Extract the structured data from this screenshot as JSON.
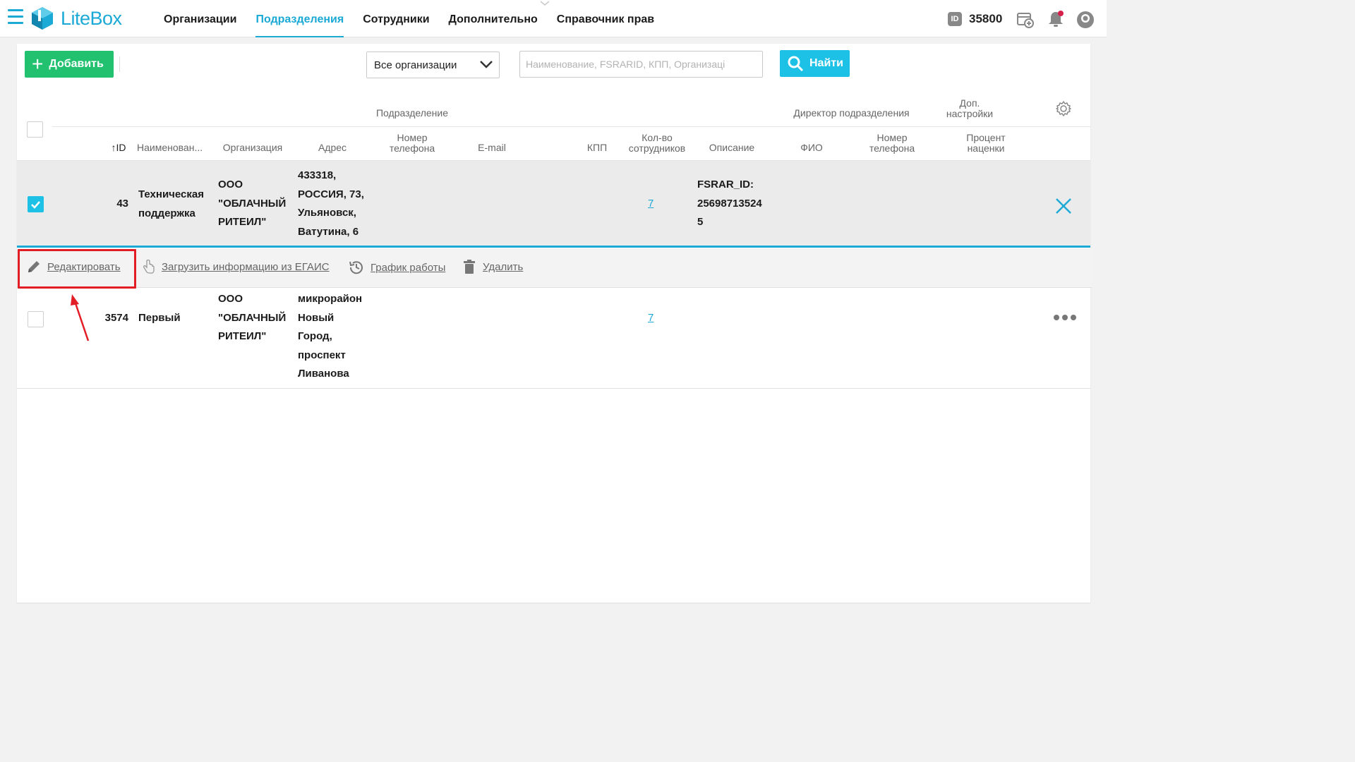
{
  "app": {
    "logo_text": "LiteBox"
  },
  "nav": {
    "items": [
      {
        "label": "Организации",
        "active": false
      },
      {
        "label": "Подразделения",
        "active": true
      },
      {
        "label": "Сотрудники",
        "active": false
      },
      {
        "label": "Дополнительно",
        "active": false
      },
      {
        "label": "Справочник прав",
        "active": false
      }
    ]
  },
  "topbar": {
    "id_badge": "ID",
    "account_id": "35800"
  },
  "toolbar": {
    "add_label": "Добавить",
    "org_select_value": "Все организации",
    "search_placeholder": "Наименование, FSRARID, КПП, Организаці",
    "find_label": "Найти"
  },
  "table": {
    "group_headers": {
      "subdivision": "Подразделение",
      "director": "Директор подразделения",
      "extra_line1": "Доп.",
      "extra_line2": "настройки"
    },
    "columns": {
      "id": "ID",
      "name": "Наименован...",
      "organization": "Организация",
      "address": "Адрес",
      "phone_line1": "Номер",
      "phone_line2": "телефона",
      "email": "E-mail",
      "kpp": "КПП",
      "employees_line1": "Кол-во",
      "employees_line2": "сотрудников",
      "description": "Описание",
      "fio": "ФИО",
      "dir_phone_line1": "Номер",
      "dir_phone_line2": "телефона",
      "markup_line1": "Процент",
      "markup_line2": "наценки"
    },
    "rows": [
      {
        "id": "43",
        "name_l1": "Техническая",
        "name_l2": "поддержка",
        "org_l1": "ООО",
        "org_l2": "\"ОБЛАЧНЫЙ",
        "org_l3": "РИТЕИЛ\"",
        "addr_l1": "433318,",
        "addr_l2": "РОССИЯ, 73,",
        "addr_l3": "Ульяновск,",
        "addr_l4": "Ватутина, 6",
        "employees": "7",
        "desc_l1": "FSRAR_ID:",
        "desc_l2": "25698713524",
        "desc_l3": "5",
        "checked": true
      },
      {
        "id": "3574",
        "name_l1": "Первый",
        "org_l1": "ООО",
        "org_l2": "\"ОБЛАЧНЫЙ",
        "org_l3": "РИТЕИЛ\"",
        "addr_l1": "микрорайон",
        "addr_l2": "Новый",
        "addr_l3": "Город,",
        "addr_l4": "проспект",
        "addr_l5": "Ливанова",
        "employees": "7",
        "checked": false
      }
    ]
  },
  "actions": {
    "edit": "Редактировать",
    "load_egais": "Загрузить информацию из ЕГАИС",
    "schedule": "График работы",
    "delete": "Удалить"
  },
  "colors": {
    "accent": "#1ba9d6",
    "add_button": "#21c16f",
    "find_button": "#1ec1e6",
    "highlight": "#e21d25"
  }
}
